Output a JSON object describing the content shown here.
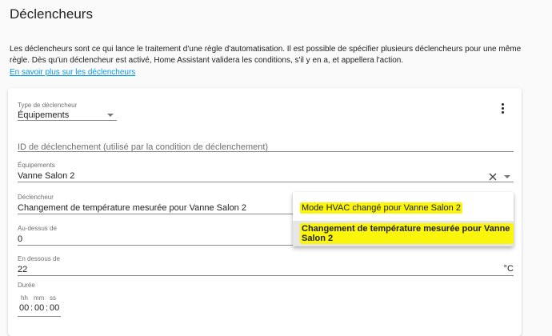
{
  "page": {
    "title": "Déclencheurs",
    "intro": "Les déclencheurs sont ce qui lance le traitement d'une règle d'automatisation. Il est possible de spécifier plusieurs déclencheurs pour une même règle. Dès qu'un déclencheur est activé, Home Assistant validera les conditions, s'il y en a, et appellera l'action.",
    "learn_more": "En savoir plus sur les déclencheurs"
  },
  "trigger": {
    "type_label": "Type de déclencheur",
    "type_value": "Équipements",
    "id_placeholder": "ID de déclenchement (utilisé par la condition de déclenchement)",
    "device_label": "Équipements",
    "device_value": "Vanne Salon 2",
    "trigger_label": "Déclencheur",
    "trigger_value": "Changement de température mesurée pour Vanne Salon 2",
    "above_label": "Au-dessus de",
    "above_value": "0",
    "below_label": "En dessous de",
    "below_value": "22",
    "below_unit": "°C",
    "duration_label": "Durée",
    "duration": {
      "hh_label": "hh",
      "mm_label": "mm",
      "ss_label": "ss",
      "hh": "00",
      "mm": "00",
      "ss": "00",
      "separator": ":"
    }
  },
  "menu": {
    "items": [
      "Mode HVAC changé pour Vanne Salon 2",
      "Changement de température mesurée pour Vanne Salon 2"
    ],
    "selected_index": 1,
    "highlight_color": "#faf50a"
  },
  "icons": {
    "overflow": "more-vert-icon",
    "clear": "close-icon",
    "dropdown": "arrow-drop-down-icon"
  }
}
